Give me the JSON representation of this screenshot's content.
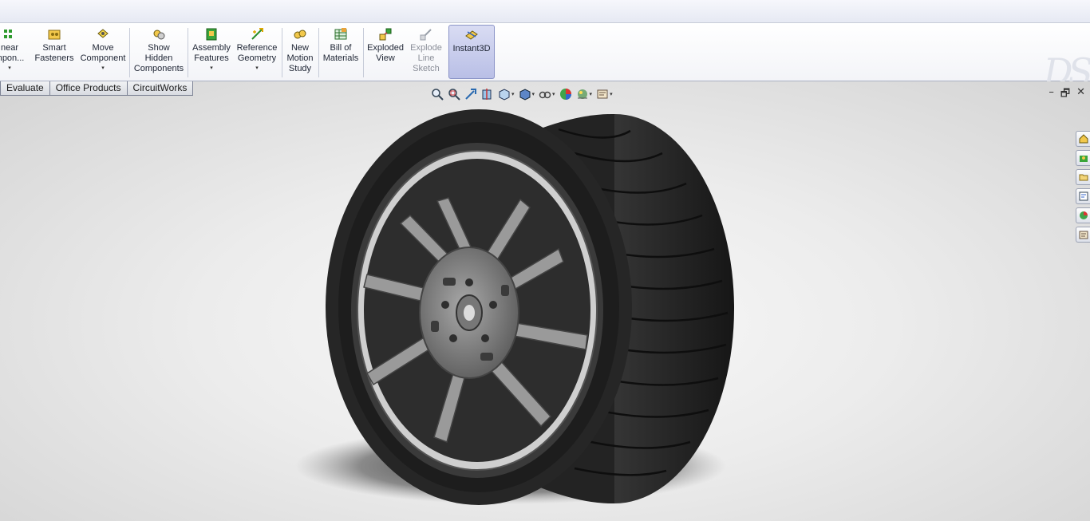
{
  "ribbon": {
    "commands": [
      {
        "label": "near\nmpon...",
        "icon": "linear-pattern-icon",
        "dropdown": true
      },
      {
        "label": "Smart\nFasteners",
        "icon": "smart-fasteners-icon",
        "dropdown": false
      },
      {
        "label": "Move\nComponent",
        "icon": "move-component-icon",
        "dropdown": true
      },
      {
        "label": "Show\nHidden\nComponents",
        "icon": "show-hidden-icon",
        "dropdown": false
      },
      {
        "label": "Assembly\nFeatures",
        "icon": "assembly-features-icon",
        "dropdown": true
      },
      {
        "label": "Reference\nGeometry",
        "icon": "reference-geometry-icon",
        "dropdown": true
      },
      {
        "label": "New\nMotion\nStudy",
        "icon": "motion-study-icon",
        "dropdown": false
      },
      {
        "label": "Bill of\nMaterials",
        "icon": "bill-of-materials-icon",
        "dropdown": false
      },
      {
        "label": "Exploded\nView",
        "icon": "exploded-view-icon",
        "dropdown": false
      },
      {
        "label": "Explode\nLine\nSketch",
        "icon": "explode-line-sketch-icon",
        "dropdown": false,
        "disabled": true
      },
      {
        "label": "Instant3D",
        "icon": "instant3d-icon",
        "dropdown": false,
        "active": true
      }
    ],
    "logo_text": "DS"
  },
  "tabs": [
    "Evaluate",
    "Office Products",
    "CircuitWorks"
  ],
  "headsup_icons": [
    "zoom-to-fit-icon",
    "zoom-to-area-icon",
    "previous-view-icon",
    "section-view-icon",
    "view-orientation-icon",
    "display-style-icon",
    "hide-show-items-icon",
    "edit-appearance-icon",
    "apply-scene-icon",
    "view-settings-icon"
  ],
  "window_controls": {
    "minimize": "–",
    "restore": "🗗",
    "close": "✕"
  },
  "task_pane": [
    "solidworks-resources-icon",
    "design-library-icon",
    "file-explorer-icon",
    "view-palette-icon",
    "appearances-icon",
    "custom-properties-icon"
  ],
  "colors": {
    "accent": "#b9bfe6",
    "tire": "#2a2a2a",
    "rim": "#8c8c8c"
  }
}
